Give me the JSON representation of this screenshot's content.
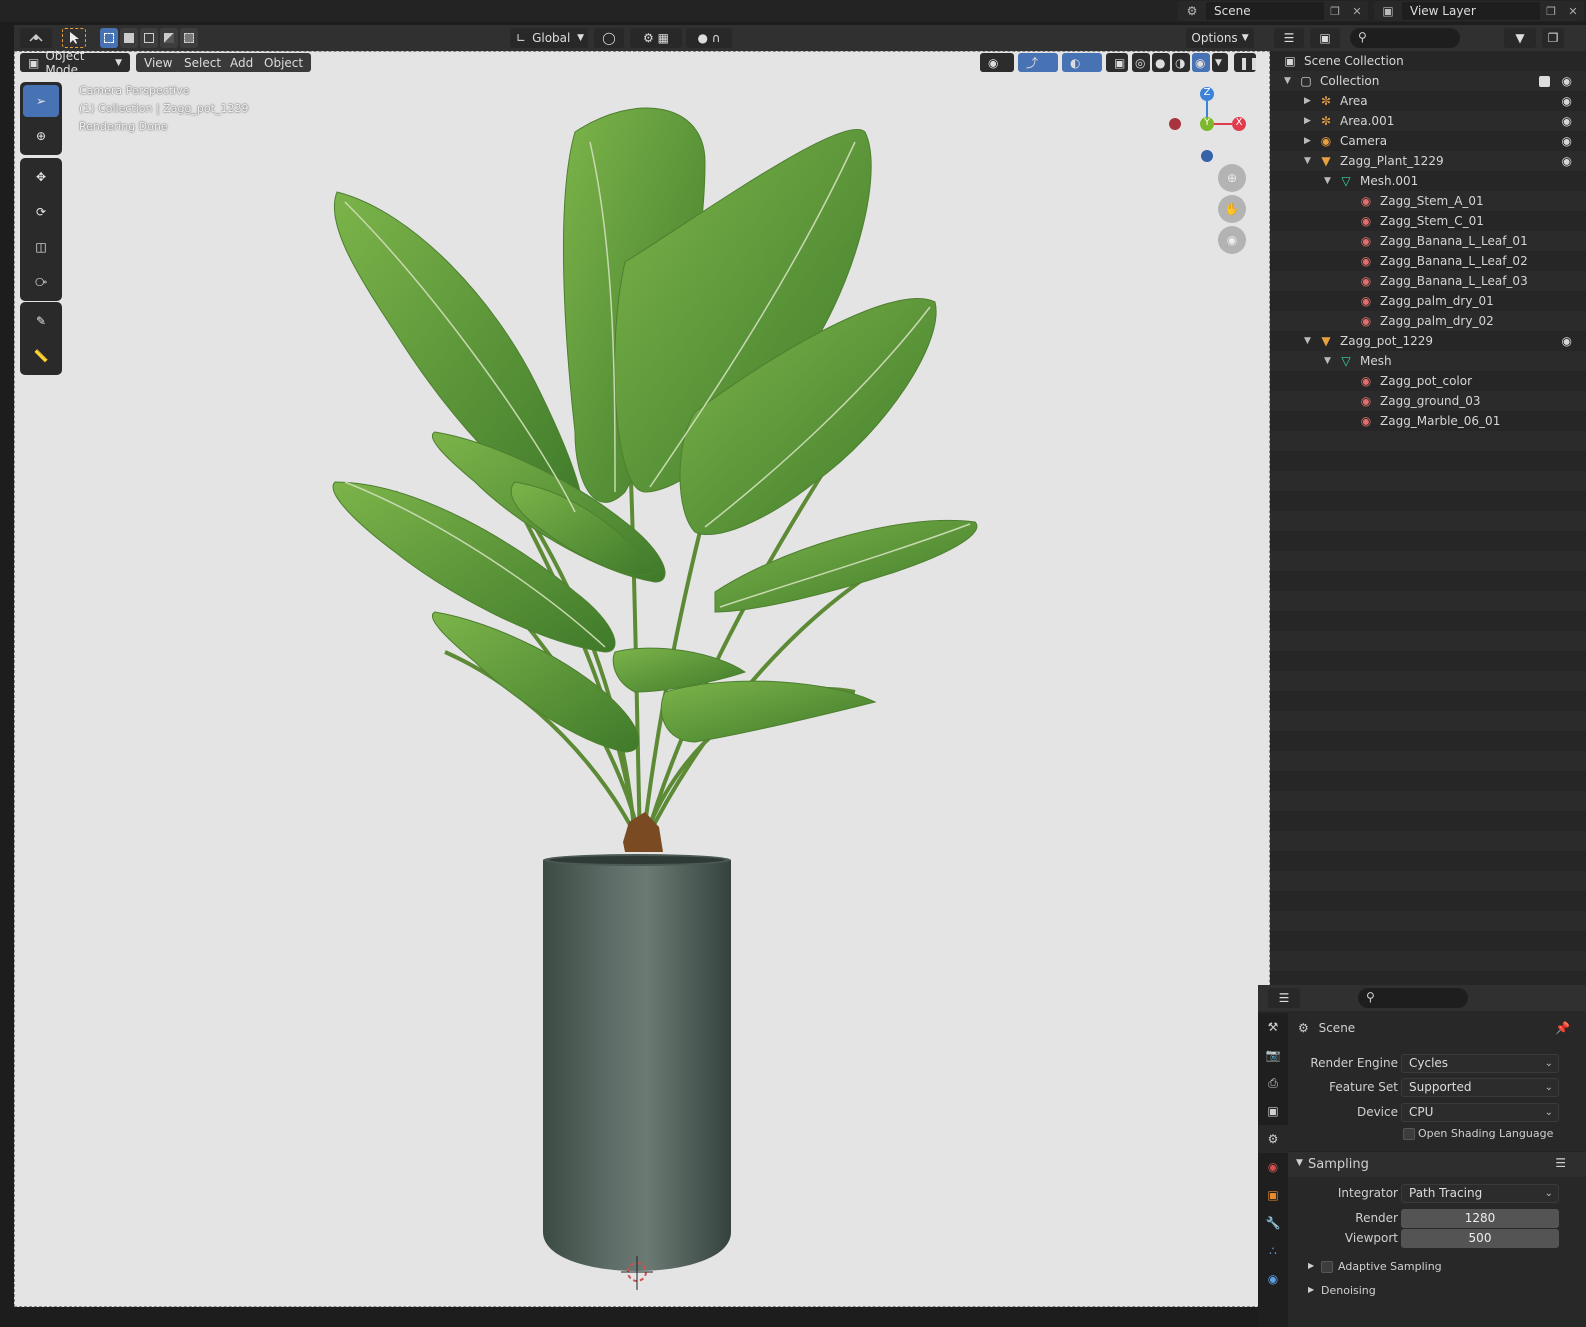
{
  "topbar": {
    "scene_label": "Scene",
    "view_layer_label": "View Layer"
  },
  "viewport_header": {
    "orientation": "Global",
    "options_label": "Options"
  },
  "menu": {
    "mode": "Object Mode",
    "view": "View",
    "select": "Select",
    "add": "Add",
    "object": "Object"
  },
  "overlay": {
    "line1": "Camera Perspective",
    "line2": "(1) Collection | Zagg_pot_1229",
    "line3": "Rendering Done"
  },
  "gizmo": {
    "z": "Z",
    "y": "Y",
    "x": "X"
  },
  "outliner": {
    "root": "Scene Collection",
    "rows": [
      {
        "label": "Collection",
        "icon": "collection-icon"
      },
      {
        "label": "Area",
        "icon": "light-icon"
      },
      {
        "label": "Area.001",
        "icon": "light-icon"
      },
      {
        "label": "Camera",
        "icon": "camera-icon"
      },
      {
        "label": "Zagg_Plant_1229",
        "icon": "object-icon"
      },
      {
        "label": "Mesh.001",
        "icon": "mesh-icon"
      },
      {
        "label": "Zagg_Stem_A_01",
        "icon": "material-icon"
      },
      {
        "label": "Zagg_Stem_C_01",
        "icon": "material-icon"
      },
      {
        "label": "Zagg_Banana_L_Leaf_01",
        "icon": "material-icon"
      },
      {
        "label": "Zagg_Banana_L_Leaf_02",
        "icon": "material-icon"
      },
      {
        "label": "Zagg_Banana_L_Leaf_03",
        "icon": "material-icon"
      },
      {
        "label": "Zagg_palm_dry_01",
        "icon": "material-icon"
      },
      {
        "label": "Zagg_palm_dry_02",
        "icon": "material-icon"
      },
      {
        "label": "Zagg_pot_1229",
        "icon": "object-icon"
      },
      {
        "label": "Mesh",
        "icon": "mesh-icon"
      },
      {
        "label": "Zagg_pot_color",
        "icon": "material-icon"
      },
      {
        "label": "Zagg_ground_03",
        "icon": "material-icon"
      },
      {
        "label": "Zagg_Marble_06_01",
        "icon": "material-icon"
      }
    ]
  },
  "properties": {
    "context": "Scene",
    "render_engine_label": "Render Engine",
    "render_engine": "Cycles",
    "feature_set_label": "Feature Set",
    "feature_set": "Supported",
    "device_label": "Device",
    "device": "CPU",
    "osl_label": "Open Shading Language",
    "sampling_label": "Sampling",
    "integrator_label": "Integrator",
    "integrator": "Path Tracing",
    "render_label": "Render",
    "render_samples": "1280",
    "viewport_label": "Viewport",
    "viewport_samples": "500",
    "adaptive_label": "Adaptive Sampling",
    "denoising_label": "Denoising"
  },
  "colors": {
    "accent": "#4772b3",
    "x_axis": "#e03c4f",
    "y_axis": "#7cb82a",
    "z_axis": "#3b82d8"
  }
}
